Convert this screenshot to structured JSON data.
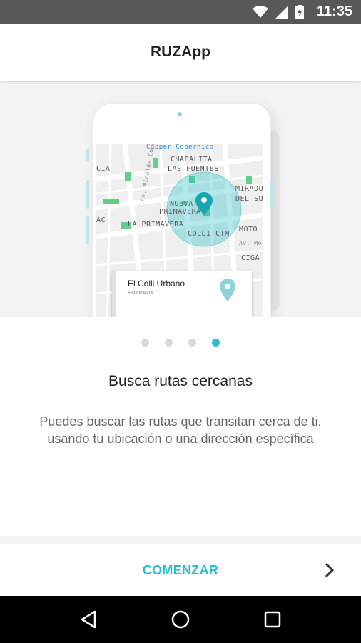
{
  "status_bar": {
    "time": "11:35",
    "icons": [
      "wifi-icon",
      "signal-icon",
      "battery-icon"
    ]
  },
  "app_bar": {
    "title": "RUZApp"
  },
  "illustration": {
    "map_labels": [
      "Copper Copérnico",
      "CHAPALITA",
      "LAS FUENTES",
      "CIA",
      "MIRADO",
      "DEL SU",
      "NUEVA",
      "PRIMAVERA",
      "AC",
      "LA PRIMAVERA",
      "COLLI CTM",
      "MOTO",
      "CIGA",
      "Av. Nicolás Copérnico",
      "Av. Moct"
    ],
    "card_title": "El Colli  Urbano",
    "card_subtitle": "ENTRADA"
  },
  "pager": {
    "count": 4,
    "active_index": 3
  },
  "onboarding": {
    "heading": "Busca rutas cercanas",
    "description_line1": "Puedes buscar las rutas que transitan cerca de ti,",
    "description_line2": "usando tu ubicación o una dirección específica"
  },
  "footer": {
    "start_label": "COMENZAR",
    "next_icon": "chevron-right-icon"
  },
  "colors": {
    "accent": "#26c0c9",
    "status_bar": "#585858",
    "map_green": "#5fd08a"
  },
  "nav_bar": {
    "buttons": [
      "back-icon",
      "home-icon",
      "recents-icon"
    ]
  }
}
